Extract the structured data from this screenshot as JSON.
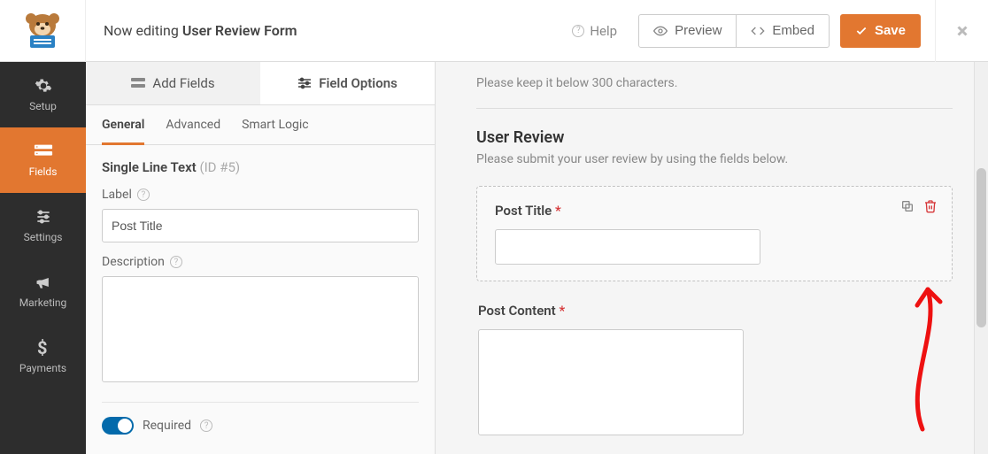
{
  "header": {
    "editing_prefix": "Now editing",
    "form_name": "User Review Form",
    "help": "Help",
    "preview": "Preview",
    "embed": "Embed",
    "save": "Save"
  },
  "rail": {
    "items": [
      {
        "label": "Setup",
        "icon": "gear-icon"
      },
      {
        "label": "Fields",
        "icon": "fields-icon"
      },
      {
        "label": "Settings",
        "icon": "sliders-icon"
      },
      {
        "label": "Marketing",
        "icon": "bullhorn-icon"
      },
      {
        "label": "Payments",
        "icon": "dollar-icon"
      }
    ]
  },
  "panel_tabs": {
    "add_fields": "Add Fields",
    "field_options": "Field Options"
  },
  "sub_tabs": {
    "general": "General",
    "advanced": "Advanced",
    "smart_logic": "Smart Logic"
  },
  "field_meta": {
    "type": "Single Line Text",
    "id_text": "(ID #5)"
  },
  "options": {
    "label_label": "Label",
    "label_value": "Post Title",
    "description_label": "Description",
    "description_value": "",
    "required_label": "Required"
  },
  "preview": {
    "hint_top": "Please keep it below 300 characters.",
    "section_title": "User Review",
    "section_desc": "Please submit your user review by using the fields below.",
    "fields": [
      {
        "label": "Post Title",
        "required": true,
        "kind": "text",
        "selected": true
      },
      {
        "label": "Post Content",
        "required": true,
        "kind": "textarea",
        "selected": false
      }
    ]
  }
}
